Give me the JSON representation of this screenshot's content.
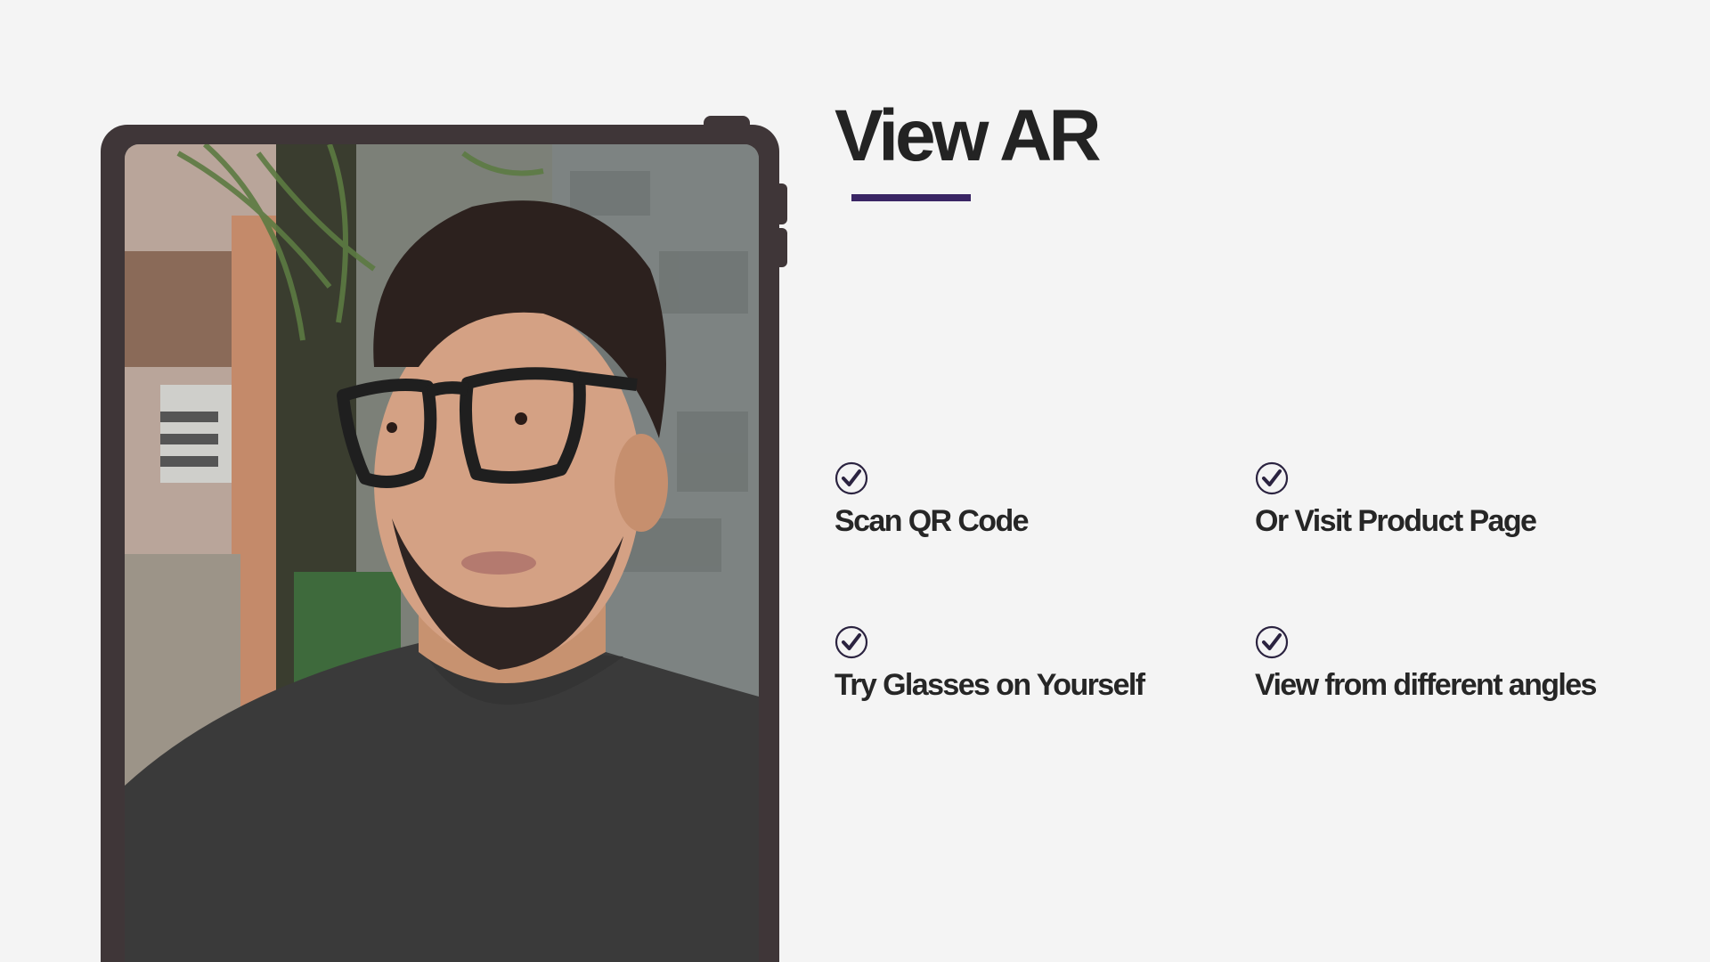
{
  "title": "View AR",
  "accent_color": "#3a2564",
  "device_color": "#3f3638",
  "features": [
    {
      "label": "Scan QR Code",
      "icon": "check-circle-icon"
    },
    {
      "label": "Or Visit Product Page",
      "icon": "check-circle-icon"
    },
    {
      "label": "Try Glasses on Yourself",
      "icon": "check-circle-icon"
    },
    {
      "label": "View from different angles",
      "icon": "check-circle-icon"
    }
  ],
  "preview": {
    "image": "ar-glasses-try-on-photo"
  }
}
